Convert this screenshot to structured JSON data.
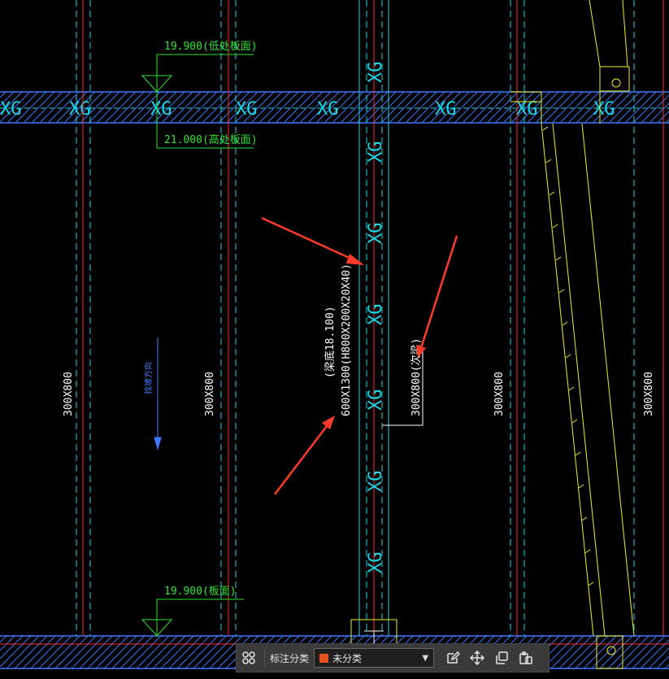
{
  "drawing": {
    "hatch_label": "XG",
    "elev_top_1": "19.900(低处板面)",
    "elev_top_2": "21.000(高处板面)",
    "elev_bottom": "19.900(板面)",
    "beam_size": "300X800",
    "beam_annot_main": "600X1300(H800X200X20X40)",
    "beam_annot_sub": "(梁底18.100)",
    "beam_annot_right": "300X800(次梁)",
    "slope_label": "找坡方向"
  },
  "colors": {
    "background": "#000000",
    "axis_line": "#ff2a2a",
    "beam_line": "#16d8e8",
    "slab_hatch": "#3b7bff",
    "elevation": "#2de52d",
    "stair": "#f0f020",
    "annotation": "#ffffff",
    "arrow": "#ff3a2a",
    "category_swatch": "#e8501e"
  },
  "toolbar": {
    "grid_icon": "grid-icon",
    "label": "标注分类",
    "selected": "未分类",
    "edit_icon": "edit-icon",
    "move_icon": "move-icon",
    "copy_icon": "copy-icon",
    "paste_icon": "paste-icon"
  }
}
